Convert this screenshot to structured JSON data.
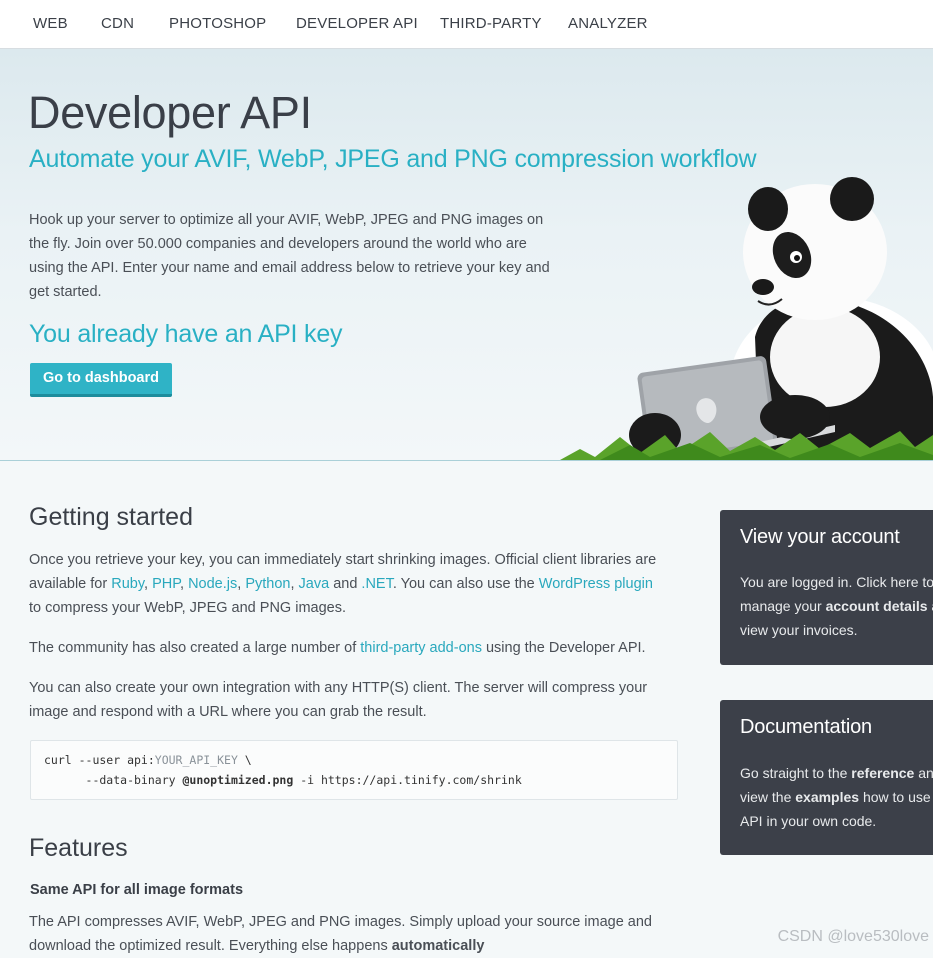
{
  "nav": {
    "items": [
      "WEB",
      "CDN",
      "PHOTOSHOP",
      "DEVELOPER API",
      "THIRD-PARTY",
      "ANALYZER"
    ]
  },
  "hero": {
    "title": "Developer API",
    "subtitle": "Automate your AVIF, WebP, JPEG and PNG compression workflow",
    "text": "Hook up your server to optimize all your AVIF, WebP, JPEG and PNG images on the fly. Join over 50.000 companies and developers around the world who are using the API. Enter your name and email address below to retrieve your key and get started.",
    "key_heading": "You already have an API key",
    "dashboard_button": "Go to dashboard"
  },
  "getting_started": {
    "heading": "Getting started",
    "p1_a": "Once you retrieve your key, you can immediately start shrinking images. Official client libraries are available for ",
    "libs": [
      "Ruby",
      "PHP",
      "Node.js",
      "Python",
      "Java",
      ".NET"
    ],
    "sep_comma": ", ",
    "sep_and": " and ",
    "p1_b": ". You can also use the ",
    "wordpress_link": "WordPress plugin",
    "p1_c": " to compress your WebP, JPEG and PNG images.",
    "p2_a": "The community has also created a large number of ",
    "addons_link": "third-party add-ons",
    "p2_b": " using the Developer API.",
    "p3": "You can also create your own integration with any HTTP(S) client. The server will compress your image and respond with a URL where you can grab the result.",
    "code": {
      "l1_a": "curl --user api:",
      "l1_var": "YOUR_API_KEY",
      "l1_b": " \\",
      "l2_a": "      --data-binary ",
      "l2_bold": "@unoptimized.png",
      "l2_b": " -i https://api.tinify.com/shrink"
    }
  },
  "features": {
    "heading": "Features",
    "subheading": "Same API for all image formats",
    "text_a": "The API compresses AVIF, WebP, JPEG and PNG images. Simply upload your source image and download the optimized result. Everything else happens ",
    "text_bold": "automatically"
  },
  "account_card": {
    "title": "View your account",
    "t1": "You are logged in. Click here to manage your ",
    "bold": "account details",
    "t2": " and view your invoices."
  },
  "docs_card": {
    "title": "Documentation",
    "t1": "Go straight to the ",
    "b1": "reference",
    "t2": " and view the ",
    "b2": "examples",
    "t3": " how to use the API in your own code."
  },
  "watermark": "CSDN @love530love",
  "colors": {
    "accent": "#2fb3c6",
    "card_bg": "#3c4049",
    "text": "#3a3f47"
  }
}
